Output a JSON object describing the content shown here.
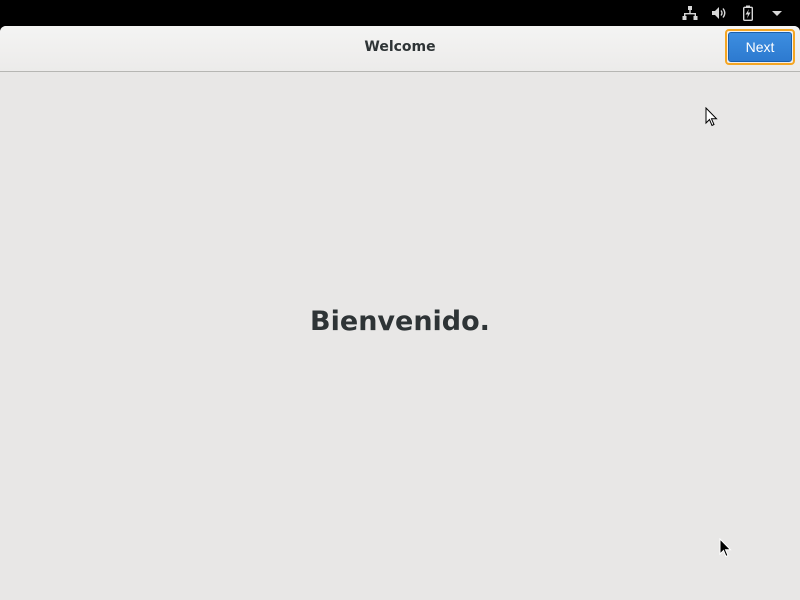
{
  "system_tray": {
    "icons": [
      "network-wired-icon",
      "volume-icon",
      "battery-charging-icon",
      "menu-dropdown-arrow-icon"
    ]
  },
  "header": {
    "title": "Welcome",
    "next_label": "Next"
  },
  "main": {
    "welcome_text": "Bienvenido."
  },
  "colors": {
    "accent": "#3584e4",
    "focus_ring": "#f5a623",
    "background": "#e8e7e6",
    "text": "#2e3436"
  }
}
